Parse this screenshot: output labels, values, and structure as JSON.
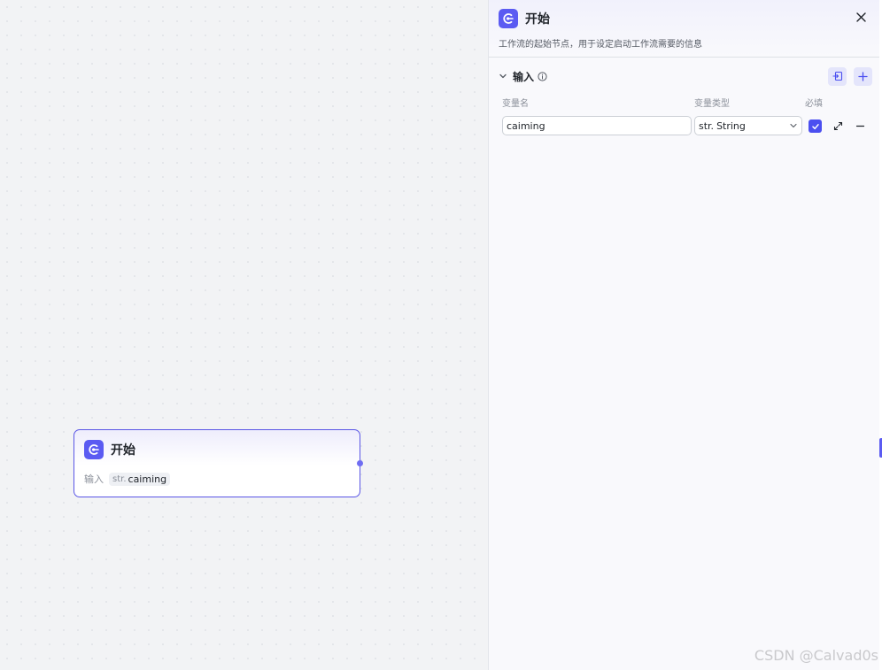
{
  "node": {
    "title": "开始",
    "input_label": "输入",
    "var_type": "str.",
    "var_name": "caiming"
  },
  "panel": {
    "title": "开始",
    "description": "工作流的起始节点，用于设定启动工作流需要的信息",
    "section_title": "输入",
    "columns": {
      "name": "变量名",
      "type": "变量类型",
      "required": "必填"
    },
    "variables": [
      {
        "name": "caiming",
        "type_prefix": "str.",
        "type": "String",
        "required": true
      }
    ]
  },
  "watermark": "CSDN @Calvad0s",
  "colors": {
    "accent": "#5b5bf2",
    "node_border": "#5a56e6",
    "checkbox": "#4b4ff0"
  },
  "icons": {
    "app": "start-node-icon",
    "close": "close-icon",
    "collapse": "chevron-down-icon",
    "info": "info-icon",
    "import": "import-icon",
    "add": "plus-icon",
    "expand": "expand-icon",
    "remove": "minus-icon"
  }
}
